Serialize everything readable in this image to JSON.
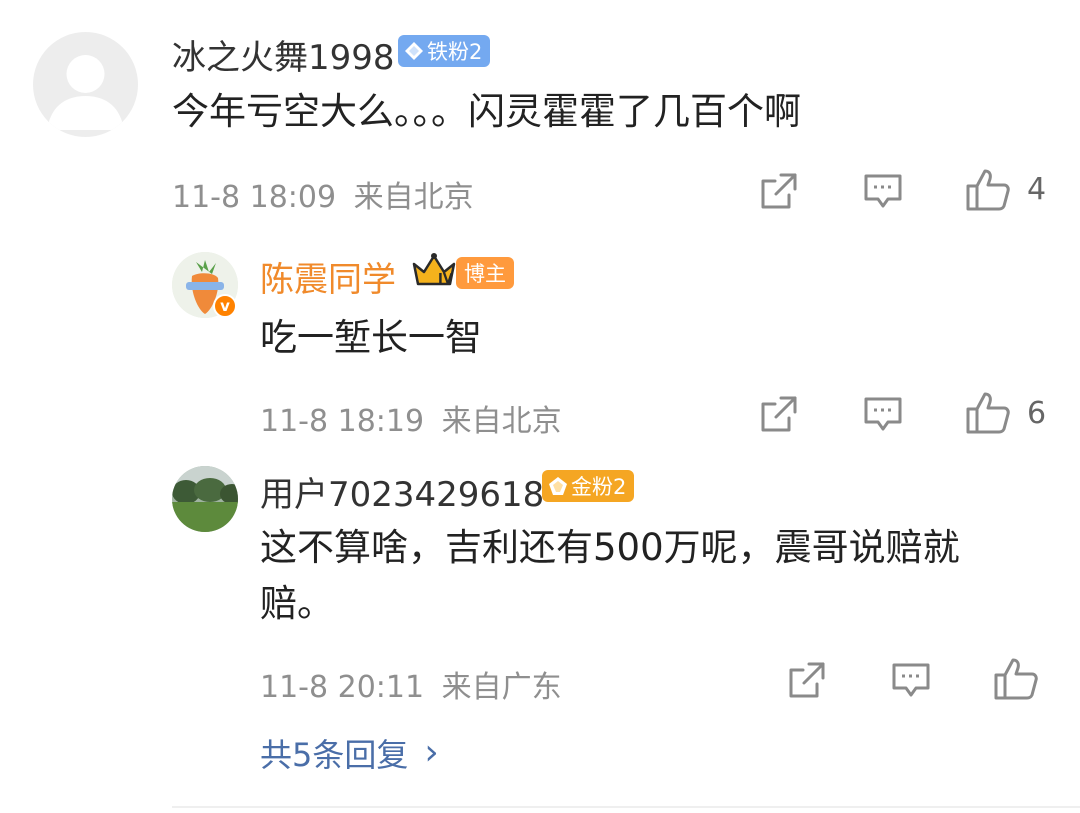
{
  "comment": {
    "username": "冰之火舞1998",
    "badge": "铁粉2",
    "text": "今年亏空大么。。。闪灵霍霍了几百个啊",
    "time": "11-8 18:09",
    "location": "来自北京",
    "likes": "4"
  },
  "replies": [
    {
      "username": "陈震同学",
      "badge": "博主",
      "crown_label": "IV",
      "verified_mark": "v",
      "text": "吃一堑长一智",
      "time": "11-8 18:19",
      "location": "来自北京",
      "likes": "6"
    },
    {
      "username": "用户7023429618",
      "badge": "金粉2",
      "text_line1": "这不算啥，吉利还有500万呢，震哥说赔就",
      "text_line2": "赔。",
      "time": "11-8 20:11",
      "location": "来自广东",
      "likes": ""
    }
  ],
  "more_replies": {
    "label": "共5条回复",
    "chevron": "›"
  },
  "icons": {
    "share": "share-icon",
    "comment": "comment-icon",
    "like": "thumbs-up-icon"
  },
  "colors": {
    "tie_badge": "#74a9f0",
    "blogger_badge": "#ff9a3d",
    "gold_badge": "#f5a623",
    "name_blogger": "#f08a2b",
    "link": "#4a6ea8"
  }
}
